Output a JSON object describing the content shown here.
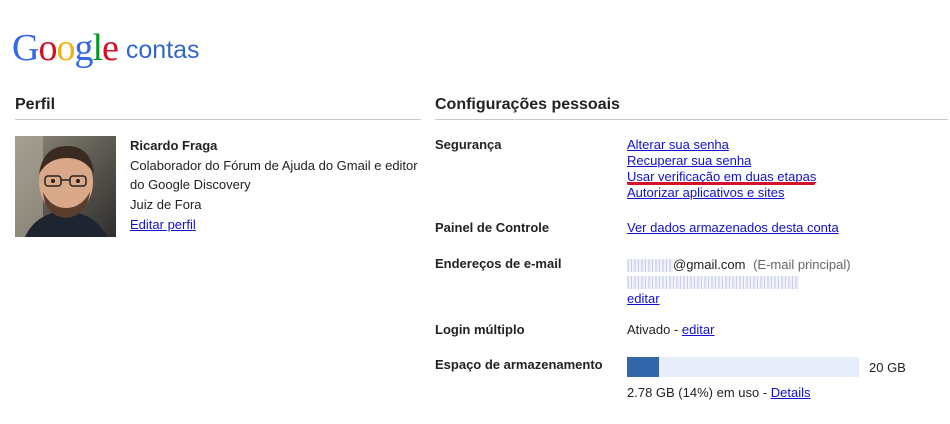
{
  "header": {
    "logo_letters": [
      "G",
      "o",
      "o",
      "g",
      "l",
      "e"
    ],
    "product": "contas"
  },
  "profile": {
    "section_title": "Perfil",
    "name": "Ricardo Fraga",
    "description": "Colaborador do Fórum de Ajuda do Gmail e editor do Google Discovery",
    "location": "Juiz de Fora",
    "edit_link": "Editar perfil"
  },
  "settings": {
    "section_title": "Configurações pessoais",
    "security": {
      "label": "Segurança",
      "links": [
        "Alterar sua senha",
        "Recuperar sua senha",
        "Usar verificação em duas etapas",
        "Autorizar aplicativos e sites"
      ]
    },
    "dashboard": {
      "label": "Painel de Controle",
      "link": "Ver dados armazenados desta conta"
    },
    "email": {
      "label": "Endereços de e-mail",
      "domain": "@gmail.com",
      "primary_tag": "(E-mail principal)",
      "edit_link": "editar"
    },
    "multi_login": {
      "label": "Login múltiplo",
      "status": "Ativado - ",
      "edit_link": "editar"
    },
    "storage": {
      "label": "Espaço de armazenamento",
      "total": "20 GB",
      "usage_text": "2.78 GB (14%) em uso - ",
      "details_link": "Details",
      "used_fraction": 0.14
    }
  },
  "colors": {
    "link": "#1111cc",
    "annotation_red": "#d3112a",
    "storage_fill": "#3366aa",
    "storage_track": "#e8eef9"
  }
}
